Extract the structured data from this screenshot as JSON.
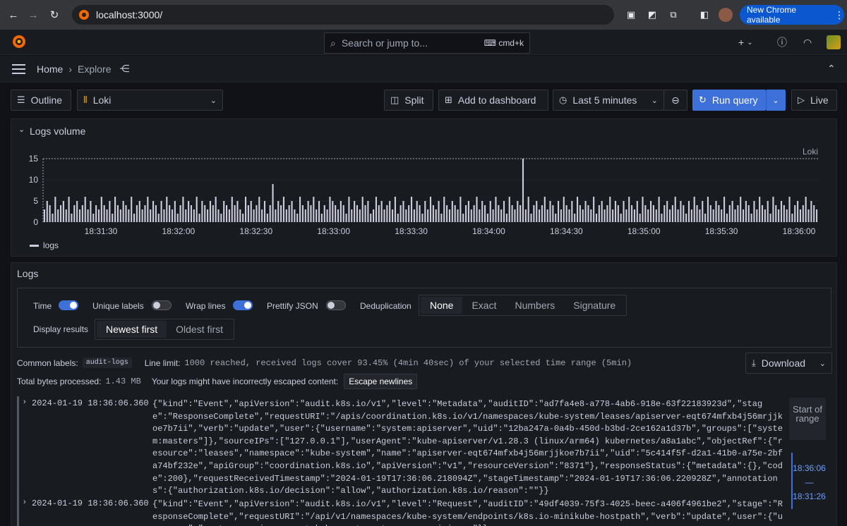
{
  "browser": {
    "url": "localhost:3000/",
    "new_chrome_label": "New Chrome available"
  },
  "topbar": {
    "search_placeholder": "Search or jump to...",
    "search_shortcut": "cmd+k"
  },
  "breadcrumb": {
    "home": "Home",
    "current": "Explore"
  },
  "toolbar": {
    "outline_label": "Outline",
    "datasource": "Loki",
    "split_label": "Split",
    "add_dashboard_label": "Add to dashboard",
    "time_range": "Last 5 minutes",
    "run_query_label": "Run query",
    "live_label": "Live"
  },
  "logs_volume": {
    "title": "Logs volume",
    "series_corner_label": "Loki",
    "legend": "logs",
    "accent": "#ccccdc"
  },
  "chart_data": {
    "type": "bar",
    "title": "Logs volume",
    "ylim": [
      0,
      15
    ],
    "y_ticks": [
      "0",
      "5",
      "10",
      "15"
    ],
    "x_ticks": [
      "18:31:30",
      "18:32:00",
      "18:32:30",
      "18:33:00",
      "18:33:30",
      "18:34:00",
      "18:34:30",
      "18:35:00",
      "18:35:30",
      "18:36:00"
    ],
    "series": [
      {
        "name": "logs",
        "values": [
          3,
          5,
          4,
          2,
          6,
          3,
          4,
          5,
          3,
          6,
          2,
          4,
          5,
          3,
          4,
          6,
          3,
          5,
          2,
          4,
          3,
          6,
          4,
          3,
          5,
          2,
          6,
          4,
          3,
          5,
          4,
          3,
          6,
          2,
          4,
          5,
          3,
          4,
          6,
          3,
          5,
          4,
          2,
          5,
          3,
          6,
          4,
          3,
          5,
          2,
          4,
          6,
          3,
          5,
          4,
          3,
          6,
          2,
          5,
          4,
          3,
          5,
          4,
          6,
          3,
          2,
          5,
          4,
          3,
          6,
          4,
          5,
          3,
          2,
          6,
          4,
          5,
          3,
          4,
          6,
          3,
          5,
          2,
          4,
          9,
          3,
          5,
          4,
          6,
          3,
          4,
          5,
          3,
          2,
          6,
          4,
          3,
          5,
          4,
          6,
          3,
          5,
          2,
          4,
          3,
          6,
          5,
          4,
          3,
          5,
          4,
          2,
          6,
          3,
          5,
          4,
          3,
          6,
          4,
          5,
          2,
          3,
          6,
          4,
          5,
          3,
          4,
          5,
          3,
          6,
          2,
          4,
          5,
          3,
          4,
          6,
          3,
          5,
          4,
          2,
          5,
          3,
          6,
          4,
          3,
          5,
          2,
          6,
          4,
          3,
          5,
          4,
          3,
          6,
          2,
          4,
          5,
          3,
          4,
          6,
          3,
          5,
          4,
          2,
          5,
          3,
          6,
          4,
          3,
          5,
          2,
          6,
          4,
          3,
          5,
          4,
          15,
          3,
          6,
          2,
          4,
          5,
          3,
          4,
          6,
          3,
          5,
          4,
          2,
          5,
          3,
          6,
          4,
          3,
          5,
          2,
          6,
          4,
          3,
          5,
          4,
          3,
          6,
          2,
          4,
          5,
          3,
          4,
          6,
          3,
          5,
          4,
          2,
          5,
          3,
          6,
          4,
          3,
          5,
          2,
          6,
          4,
          3,
          5,
          4,
          3,
          6,
          2,
          4,
          5,
          3,
          4,
          6,
          3,
          5,
          4,
          2,
          5,
          3,
          6,
          4,
          3,
          5,
          2,
          6,
          4,
          3,
          5,
          4,
          3,
          6,
          2,
          4,
          5,
          3,
          4,
          6,
          3,
          5,
          4,
          2,
          5,
          3,
          6,
          4,
          3,
          5,
          2,
          6,
          4,
          3,
          5,
          4,
          3,
          6,
          2,
          4,
          5,
          3,
          4,
          6,
          3,
          5,
          4,
          3
        ]
      }
    ],
    "legend_position": "bottom-left",
    "grid": true
  },
  "logs": {
    "title": "Logs",
    "time_label": "Time",
    "unique_labels_label": "Unique labels",
    "wrap_lines_label": "Wrap lines",
    "prettify_json_label": "Prettify JSON",
    "dedup_label": "Deduplication",
    "dedup_options": [
      "None",
      "Exact",
      "Numbers",
      "Signature"
    ],
    "display_results_label": "Display results",
    "display_options": [
      "Newest first",
      "Oldest first"
    ],
    "common_labels_label": "Common labels:",
    "common_label_value": "audit-logs",
    "line_limit_label": "Line limit:",
    "line_limit_value": "1000 reached, received logs cover 93.45% (4min 40sec) of your selected time range (5min)",
    "total_bytes_label": "Total bytes processed:",
    "total_bytes_value": "1.43 MB",
    "escaped_warning": "Your logs might have incorrectly escaped content:",
    "escape_button": "Escape newlines",
    "download_label": "Download",
    "rows": [
      {
        "time": "2024-01-19 18:36:06.360",
        "line": "{\"kind\":\"Event\",\"apiVersion\":\"audit.k8s.io/v1\",\"level\":\"Metadata\",\"auditID\":\"ad7fa4e8-a778-4ab6-918e-63f22183923d\",\"stage\":\"ResponseComplete\",\"requestURI\":\"/apis/coordination.k8s.io/v1/namespaces/kube-system/leases/apiserver-eqt674mfxb4j56mrjjkoe7b7ii\",\"verb\":\"update\",\"user\":{\"username\":\"system:apiserver\",\"uid\":\"12ba247a-0a4b-450d-b3bd-2ce162a1d37b\",\"groups\":[\"system:masters\"]},\"sourceIPs\":[\"127.0.0.1\"],\"userAgent\":\"kube-apiserver/v1.28.3 (linux/arm64) kubernetes/a8a1abc\",\"objectRef\":{\"resource\":\"leases\",\"namespace\":\"kube-system\",\"name\":\"apiserver-eqt674mfxb4j56mrjjkoe7b7ii\",\"uid\":\"5c414f5f-d2a1-41b0-a75e-2bfa74bf232e\",\"apiGroup\":\"coordination.k8s.io\",\"apiVersion\":\"v1\",\"resourceVersion\":\"8371\"},\"responseStatus\":{\"metadata\":{},\"code\":200},\"requestReceivedTimestamp\":\"2024-01-19T17:36:06.218094Z\",\"stageTimestamp\":\"2024-01-19T17:36:06.220928Z\",\"annotations\":{\"authorization.k8s.io/decision\":\"allow\",\"authorization.k8s.io/reason\":\"\"}}"
      },
      {
        "time": "2024-01-19 18:36:06.360",
        "line": "{\"kind\":\"Event\",\"apiVersion\":\"audit.k8s.io/v1\",\"level\":\"Request\",\"auditID\":\"49df4039-75f3-4025-beec-a406f4961be2\",\"stage\":\"ResponseComplete\",\"requestURI\":\"/api/v1/namespaces/kube-system/endpoints/k8s.io-minikube-hostpath\",\"verb\":\"update\",\"user\":{\"username\":\"system:serviceaccount:kube-system:storage-provisioner\"}}"
      }
    ],
    "start_of_range": "Start of range",
    "range_end": "18:36:06",
    "range_dash": "—",
    "range_start": "18:31:26"
  }
}
